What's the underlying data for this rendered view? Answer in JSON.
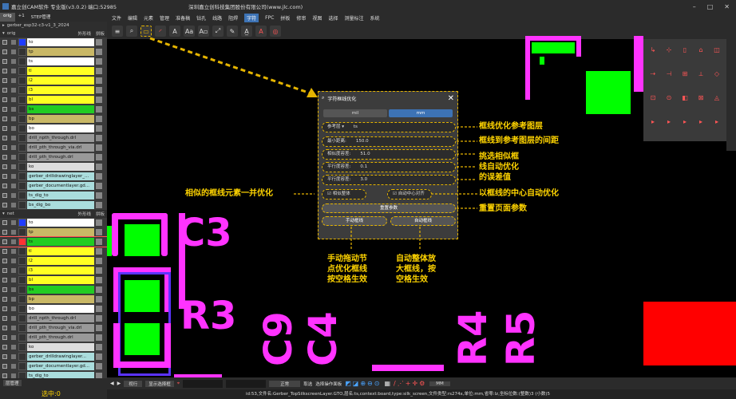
{
  "window": {
    "title": "嘉立创CAM软件 专业版(v3.0.2) 端口:52985",
    "company": "深圳嘉立创科技集团股份有限公司(www.jlc.com)"
  },
  "menu": [
    "文件",
    "编辑",
    "元素",
    "管理",
    "准备稿",
    "钻孔",
    "线路",
    "阻焊",
    "字符",
    "FPC",
    "拼板",
    "修审",
    "视图",
    "选择",
    "测量标注",
    "系统"
  ],
  "menu_selected": "字符",
  "left": {
    "tabs": [
      "orig",
      "+1",
      "STEP管理"
    ],
    "job": "gerber_esp32-c3-v1_3_2024",
    "group1": {
      "name": "orig",
      "opt1": "外形线",
      "opt2": "拼板"
    },
    "group2": {
      "name": "net",
      "opt1": "外形线",
      "opt2": "拼板"
    },
    "layers1": [
      {
        "name": "to",
        "color": "#ffffff"
      },
      {
        "name": "tp",
        "color": "#c9b866"
      },
      {
        "name": "ts",
        "color": "#ffffff"
      },
      {
        "name": "tl",
        "color": "#ffff22"
      },
      {
        "name": "l2",
        "color": "#ffff22"
      },
      {
        "name": "l3",
        "color": "#ffff22"
      },
      {
        "name": "bl",
        "color": "#ffff22"
      },
      {
        "name": "bs",
        "color": "#22cc22"
      },
      {
        "name": "bp",
        "color": "#c9b866"
      },
      {
        "name": "bo",
        "color": "#ffffff"
      },
      {
        "name": "drill_npth_through.drl",
        "color": "#999999"
      },
      {
        "name": "drill_pth_through_via.drl",
        "color": "#999999"
      },
      {
        "name": "drill_pth_through.drl",
        "color": "#999999"
      },
      {
        "name": "ko",
        "color": "#dddddd"
      },
      {
        "name": "gerber_drilldrawinglayer_...",
        "color": "#aadddd"
      },
      {
        "name": "gerber_documentlayer.gd...",
        "color": "#aadddd"
      },
      {
        "name": "ts_dig_to",
        "color": "#aadddd"
      },
      {
        "name": "bs_dig_bo",
        "color": "#aadddd"
      }
    ],
    "layers2": [
      {
        "name": "to",
        "color": "#ffffff"
      },
      {
        "name": "tp",
        "color": "#c9b866"
      },
      {
        "name": "ts",
        "color": "#22cc22"
      },
      {
        "name": "tl",
        "color": "#ffff22"
      },
      {
        "name": "l2",
        "color": "#ffff22"
      },
      {
        "name": "l3",
        "color": "#ffff22"
      },
      {
        "name": "bl",
        "color": "#ffff22"
      },
      {
        "name": "bs",
        "color": "#22cc22"
      },
      {
        "name": "bp",
        "color": "#c9b866"
      },
      {
        "name": "bo",
        "color": "#ffffff"
      },
      {
        "name": "drill_npth_through.drl",
        "color": "#999999"
      },
      {
        "name": "drill_pth_through_via.drl",
        "color": "#999999"
      },
      {
        "name": "drill_pth_through.drl",
        "color": "#999999"
      },
      {
        "name": "ko",
        "color": "#dddddd"
      },
      {
        "name": "gerber_drilldrawinglayer...",
        "color": "#aadddd"
      },
      {
        "name": "gerber_documentlayer.gd...",
        "color": "#aadddd"
      },
      {
        "name": "ts_dig_to",
        "color": "#aadddd"
      }
    ],
    "bottom_tab": "层管理",
    "selected_count": "选中:0"
  },
  "canvas": {
    "labels": [
      "C3",
      "R3",
      "C9",
      "C4",
      "R4",
      "R5"
    ]
  },
  "dialog": {
    "title": "字符框线优化",
    "unit_mil": "mil",
    "unit_mm": "mm",
    "ref_label": "参考层",
    "ref_value": "ts",
    "fields": [
      {
        "label": "最小距离:",
        "value": "150.0"
      },
      {
        "label": "相似度容差:",
        "value": "51.0"
      },
      {
        "label": "平行度容差:",
        "value": "0.1"
      },
      {
        "label": "平行度容差:",
        "value": "3.0"
      }
    ],
    "chk1": "相似整体",
    "chk2": "自动中心对齐",
    "reset": "重置参数",
    "manual": "手动框线",
    "auto": "自动框线"
  },
  "annotations": {
    "a1": "框线优化参考图层",
    "a2": "框线到参考图层的间距",
    "a3": "挑选相似框\n线自动优化\n的误差值",
    "a4": "以框线的中心自动优化",
    "a5": "重置页面参数",
    "a6": "相似的框线元素一并优化",
    "a7": "手动拖动节\n点优化框线\n按空格生效",
    "a8": "自动整体放\n大框线，按\n空格生效"
  },
  "bottombar": {
    "dropdown1": "视行",
    "toggle_label": "显示选择框",
    "dropdown2": "正常",
    "opt1": "取选",
    "opt2": "选择操作面板",
    "unit": "MM"
  },
  "status": "id:53,文件名:Gerber_TopSilkscreenLayer.GTO,层名:ts,context:board,type:silk_screen,文件类型:rs274x,单位:mm,省零:lz,坐标位数:(整数)3 (小数)5"
}
